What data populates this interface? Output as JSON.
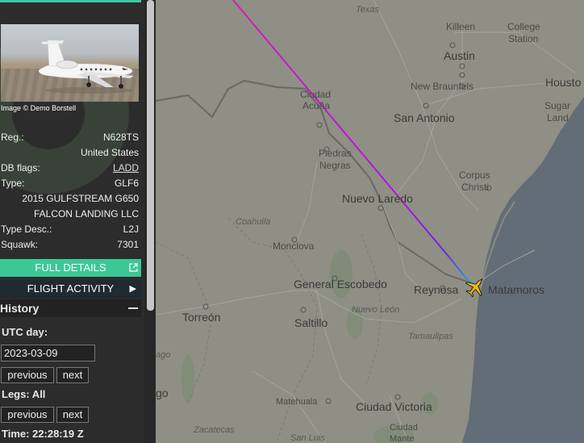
{
  "aircraft": {
    "image_credit": "Image © Demo Borstell",
    "reg_label": "Reg.:",
    "reg": "N628TS",
    "country": "United States",
    "db_flags_label": "DB flags:",
    "db_flags": "LADD",
    "type_label": "Type:",
    "type": "GLF6",
    "model": "2015 GULFSTREAM G650",
    "owner": "FALCON LANDING LLC",
    "type_desc_label": "Type Desc.:",
    "type_desc": "L2J",
    "squawk_label": "Squawk:",
    "squawk": "7301"
  },
  "buttons": {
    "full_details": "FULL DETAILS",
    "flight_activity": "FLIGHT ACTIVITY"
  },
  "history": {
    "title": "History",
    "utc_day_label": "UTC day:",
    "utc_day": "2023-03-09",
    "previous": "previous",
    "next": "next",
    "legs_label": "Legs: All",
    "time_label": "Time: 22:28:19 Z"
  },
  "map": {
    "labels": {
      "texas": "Texas",
      "killeen": "Killeen",
      "college_station": "College Station",
      "austin": "Austin",
      "houston": "Housto",
      "new_braunfels": "New Braunfels",
      "sugar_land": "Sugar Land",
      "ciudad_acuna": "Ciudad Acuña",
      "san_antonio": "San Antonio",
      "piedras_negras": "Piedras Negras",
      "corpus_christi": "Corpus Christi",
      "nuevo_laredo": "Nuevo Laredo",
      "coahuila": "Coahuila",
      "monclova": "Monclova",
      "general_escobedo": "General Escobedo",
      "reynosa": "Reynosa",
      "matamoros": "Matamoros",
      "torreon": "Torreón",
      "nuevo_leon": "Nuevo León",
      "saltillo": "Saltillo",
      "tamaulipas": "Tamaulipas",
      "durango_partial": "ago",
      "durango_partial2": "go",
      "matehuala": "Matehuala",
      "ciudad_victoria": "Ciudad Victoria",
      "zacatecas": "Zacatecas",
      "san_luis": "San Luis",
      "ciudad_mante": "Ciudad Mante"
    }
  }
}
